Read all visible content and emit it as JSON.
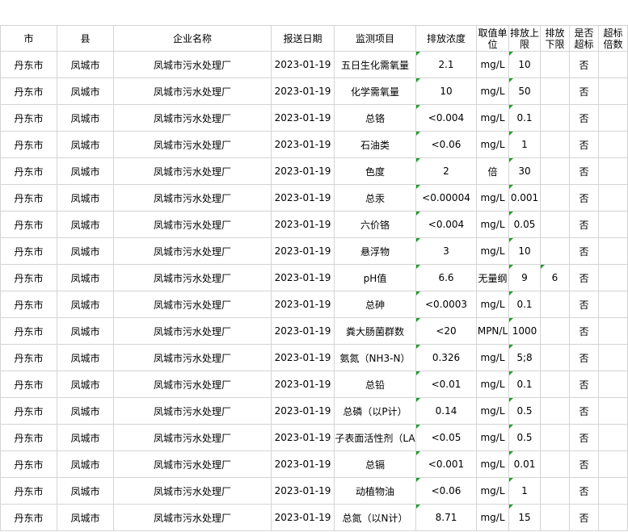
{
  "headers": {
    "city": "市",
    "county": "县",
    "company": "企业名称",
    "date": "报送日期",
    "item": "监测项目",
    "concentration": "排放浓度",
    "unit": "取值单位",
    "upper": "排放上限",
    "lower": "排放下限",
    "exceed": "是否超标",
    "multiple": "超标倍数"
  },
  "rows": [
    {
      "city": "丹东市",
      "county": "凤城市",
      "company": "凤城市污水处理厂",
      "date": "2023-01-19",
      "item": "五日生化需氧量",
      "concentration": "2.1",
      "unit": "mg/L",
      "upper": "10",
      "lower": "",
      "exceed": "否",
      "multiple": ""
    },
    {
      "city": "丹东市",
      "county": "凤城市",
      "company": "凤城市污水处理厂",
      "date": "2023-01-19",
      "item": "化学需氧量",
      "concentration": "10",
      "unit": "mg/L",
      "upper": "50",
      "lower": "",
      "exceed": "否",
      "multiple": ""
    },
    {
      "city": "丹东市",
      "county": "凤城市",
      "company": "凤城市污水处理厂",
      "date": "2023-01-19",
      "item": "总铬",
      "concentration": "<0.004",
      "unit": "mg/L",
      "upper": "0.1",
      "lower": "",
      "exceed": "否",
      "multiple": ""
    },
    {
      "city": "丹东市",
      "county": "凤城市",
      "company": "凤城市污水处理厂",
      "date": "2023-01-19",
      "item": "石油类",
      "concentration": "<0.06",
      "unit": "mg/L",
      "upper": "1",
      "lower": "",
      "exceed": "否",
      "multiple": ""
    },
    {
      "city": "丹东市",
      "county": "凤城市",
      "company": "凤城市污水处理厂",
      "date": "2023-01-19",
      "item": "色度",
      "concentration": "2",
      "unit": "倍",
      "upper": "30",
      "lower": "",
      "exceed": "否",
      "multiple": ""
    },
    {
      "city": "丹东市",
      "county": "凤城市",
      "company": "凤城市污水处理厂",
      "date": "2023-01-19",
      "item": "总汞",
      "concentration": "<0.00004",
      "unit": "mg/L",
      "upper": "0.001",
      "lower": "",
      "exceed": "否",
      "multiple": ""
    },
    {
      "city": "丹东市",
      "county": "凤城市",
      "company": "凤城市污水处理厂",
      "date": "2023-01-19",
      "item": "六价铬",
      "concentration": "<0.004",
      "unit": "mg/L",
      "upper": "0.05",
      "lower": "",
      "exceed": "否",
      "multiple": ""
    },
    {
      "city": "丹东市",
      "county": "凤城市",
      "company": "凤城市污水处理厂",
      "date": "2023-01-19",
      "item": "悬浮物",
      "concentration": "3",
      "unit": "mg/L",
      "upper": "10",
      "lower": "",
      "exceed": "否",
      "multiple": ""
    },
    {
      "city": "丹东市",
      "county": "凤城市",
      "company": "凤城市污水处理厂",
      "date": "2023-01-19",
      "item": "pH值",
      "concentration": "6.6",
      "unit": "无量纲",
      "upper": "9",
      "lower": "6",
      "exceed": "否",
      "multiple": ""
    },
    {
      "city": "丹东市",
      "county": "凤城市",
      "company": "凤城市污水处理厂",
      "date": "2023-01-19",
      "item": "总砷",
      "concentration": "<0.0003",
      "unit": "mg/L",
      "upper": "0.1",
      "lower": "",
      "exceed": "否",
      "multiple": ""
    },
    {
      "city": "丹东市",
      "county": "凤城市",
      "company": "凤城市污水处理厂",
      "date": "2023-01-19",
      "item": "粪大肠菌群数",
      "concentration": "<20",
      "unit": "MPN/L",
      "upper": "1000",
      "lower": "",
      "exceed": "否",
      "multiple": ""
    },
    {
      "city": "丹东市",
      "county": "凤城市",
      "company": "凤城市污水处理厂",
      "date": "2023-01-19",
      "item": "氨氮（NH3-N）",
      "concentration": "0.326",
      "unit": "mg/L",
      "upper": "5;8",
      "lower": "",
      "exceed": "否",
      "multiple": ""
    },
    {
      "city": "丹东市",
      "county": "凤城市",
      "company": "凤城市污水处理厂",
      "date": "2023-01-19",
      "item": "总铅",
      "concentration": "<0.01",
      "unit": "mg/L",
      "upper": "0.1",
      "lower": "",
      "exceed": "否",
      "multiple": ""
    },
    {
      "city": "丹东市",
      "county": "凤城市",
      "company": "凤城市污水处理厂",
      "date": "2023-01-19",
      "item": "总磷（以P计）",
      "concentration": "0.14",
      "unit": "mg/L",
      "upper": "0.5",
      "lower": "",
      "exceed": "否",
      "multiple": ""
    },
    {
      "city": "丹东市",
      "county": "凤城市",
      "company": "凤城市污水处理厂",
      "date": "2023-01-19",
      "item": "子表面活性剂（LA",
      "concentration": "<0.05",
      "unit": "mg/L",
      "upper": "0.5",
      "lower": "",
      "exceed": "否",
      "multiple": ""
    },
    {
      "city": "丹东市",
      "county": "凤城市",
      "company": "凤城市污水处理厂",
      "date": "2023-01-19",
      "item": "总镉",
      "concentration": "<0.001",
      "unit": "mg/L",
      "upper": "0.01",
      "lower": "",
      "exceed": "否",
      "multiple": ""
    },
    {
      "city": "丹东市",
      "county": "凤城市",
      "company": "凤城市污水处理厂",
      "date": "2023-01-19",
      "item": "动植物油",
      "concentration": "<0.06",
      "unit": "mg/L",
      "upper": "1",
      "lower": "",
      "exceed": "否",
      "multiple": ""
    },
    {
      "city": "丹东市",
      "county": "凤城市",
      "company": "凤城市污水处理厂",
      "date": "2023-01-19",
      "item": "总氮（以N计）",
      "concentration": "8.71",
      "unit": "mg/L",
      "upper": "15",
      "lower": "",
      "exceed": "否",
      "multiple": ""
    }
  ],
  "marker_color": "#1e9e2c"
}
